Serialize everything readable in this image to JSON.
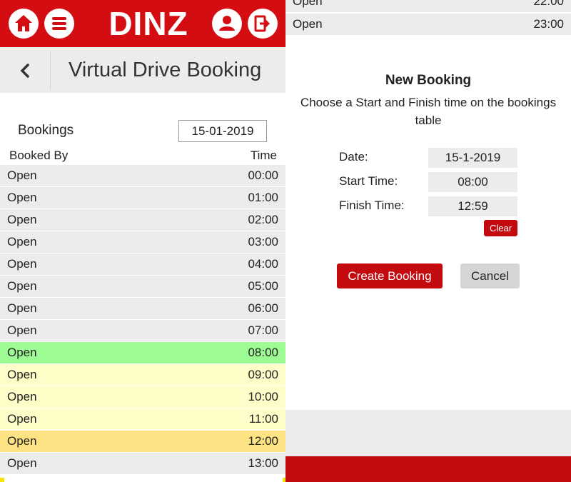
{
  "colors": {
    "brand_red": "#d40d12",
    "button_red": "#c30a0f",
    "row_grey": "#ececec",
    "selected_start": "#9dfb94",
    "selected_range": "#fffec9",
    "selected_end": "#fde384"
  },
  "header": {
    "brand": "DINZ",
    "icons": [
      "home-icon",
      "menu-icon",
      "user-icon",
      "logout-icon"
    ],
    "page_title": "Virtual Drive Booking"
  },
  "bookings": {
    "label": "Bookings",
    "date": "15-01-2019",
    "col_booked_by": "Booked By",
    "col_time": "Time",
    "rows": [
      {
        "who": "Open",
        "time": "00:00",
        "state": "open"
      },
      {
        "who": "Open",
        "time": "01:00",
        "state": "open"
      },
      {
        "who": "Open",
        "time": "02:00",
        "state": "open"
      },
      {
        "who": "Open",
        "time": "03:00",
        "state": "open"
      },
      {
        "who": "Open",
        "time": "04:00",
        "state": "open"
      },
      {
        "who": "Open",
        "time": "05:00",
        "state": "open"
      },
      {
        "who": "Open",
        "time": "06:00",
        "state": "open"
      },
      {
        "who": "Open",
        "time": "07:00",
        "state": "open"
      },
      {
        "who": "Open",
        "time": "08:00",
        "state": "start"
      },
      {
        "who": "Open",
        "time": "09:00",
        "state": "range"
      },
      {
        "who": "Open",
        "time": "10:00",
        "state": "range"
      },
      {
        "who": "Open",
        "time": "11:00",
        "state": "range"
      },
      {
        "who": "Open",
        "time": "12:00",
        "state": "end"
      },
      {
        "who": "Open",
        "time": "13:00",
        "state": "open"
      }
    ]
  },
  "right_table_rows": [
    {
      "who": "Open",
      "time": "22:00"
    },
    {
      "who": "Open",
      "time": "23:00"
    }
  ],
  "new_booking": {
    "title": "New Booking",
    "subtitle": "Choose a Start and Finish time on the bookings table",
    "date_label": "Date:",
    "date_value": "15-1-2019",
    "start_label": "Start Time:",
    "start_value": "08:00",
    "finish_label": "Finish Time:",
    "finish_value": "12:59",
    "clear_label": "Clear",
    "create_label": "Create Booking",
    "cancel_label": "Cancel"
  }
}
